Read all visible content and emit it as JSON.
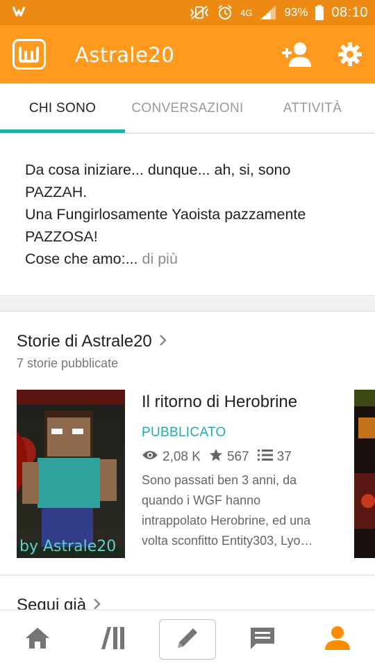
{
  "status_bar": {
    "network": "4G",
    "battery": "93%",
    "time": "08:10",
    "icons": [
      "wattpad-notification-icon",
      "vibrate-icon",
      "alarm-icon",
      "signal-icon",
      "battery-icon"
    ]
  },
  "app_bar": {
    "logo": "wattpad-logo",
    "title": "Astrale20",
    "actions": [
      "add-user-icon",
      "gear-icon"
    ]
  },
  "tabs": [
    {
      "label": "CHI SONO",
      "active": true
    },
    {
      "label": "CONVERSAZIONI",
      "active": false
    },
    {
      "label": "ATTIVITÀ",
      "active": false
    }
  ],
  "bio": {
    "lines": [
      "Da cosa iniziare... dunque... ah, si, sono",
      "PAZZAH.",
      "Una Fungirlosamente Yaoista pazzamente",
      "PAZZOSA!",
      "Cose che amo:..."
    ],
    "more": " di più"
  },
  "stories_section": {
    "title": "Storie di Astrale20",
    "subtitle": "7 storie pubblicate",
    "story": {
      "cover_caption": "by Astrale20",
      "title": "Il ritorno di Herobrine",
      "status": "PUBBLICATO",
      "reads": "2,08 K",
      "votes": "567",
      "parts": "37",
      "description_lines": [
        "Sono passati ben 3 anni, da",
        "quando i WGF hanno",
        "intrappolato Herobrine, ed una",
        "volta sconfitto Entity303, Lyo…"
      ]
    }
  },
  "following_section": {
    "title": "Segui già"
  },
  "bottom_nav": [
    "home-icon",
    "library-icon",
    "write-icon",
    "messages-icon",
    "profile-icon"
  ],
  "colors": {
    "status_bar": "#ec8a13",
    "app_bar": "#ff9a1f",
    "accent_teal": "#22b2b2",
    "active_nav": "#ff8c00"
  }
}
